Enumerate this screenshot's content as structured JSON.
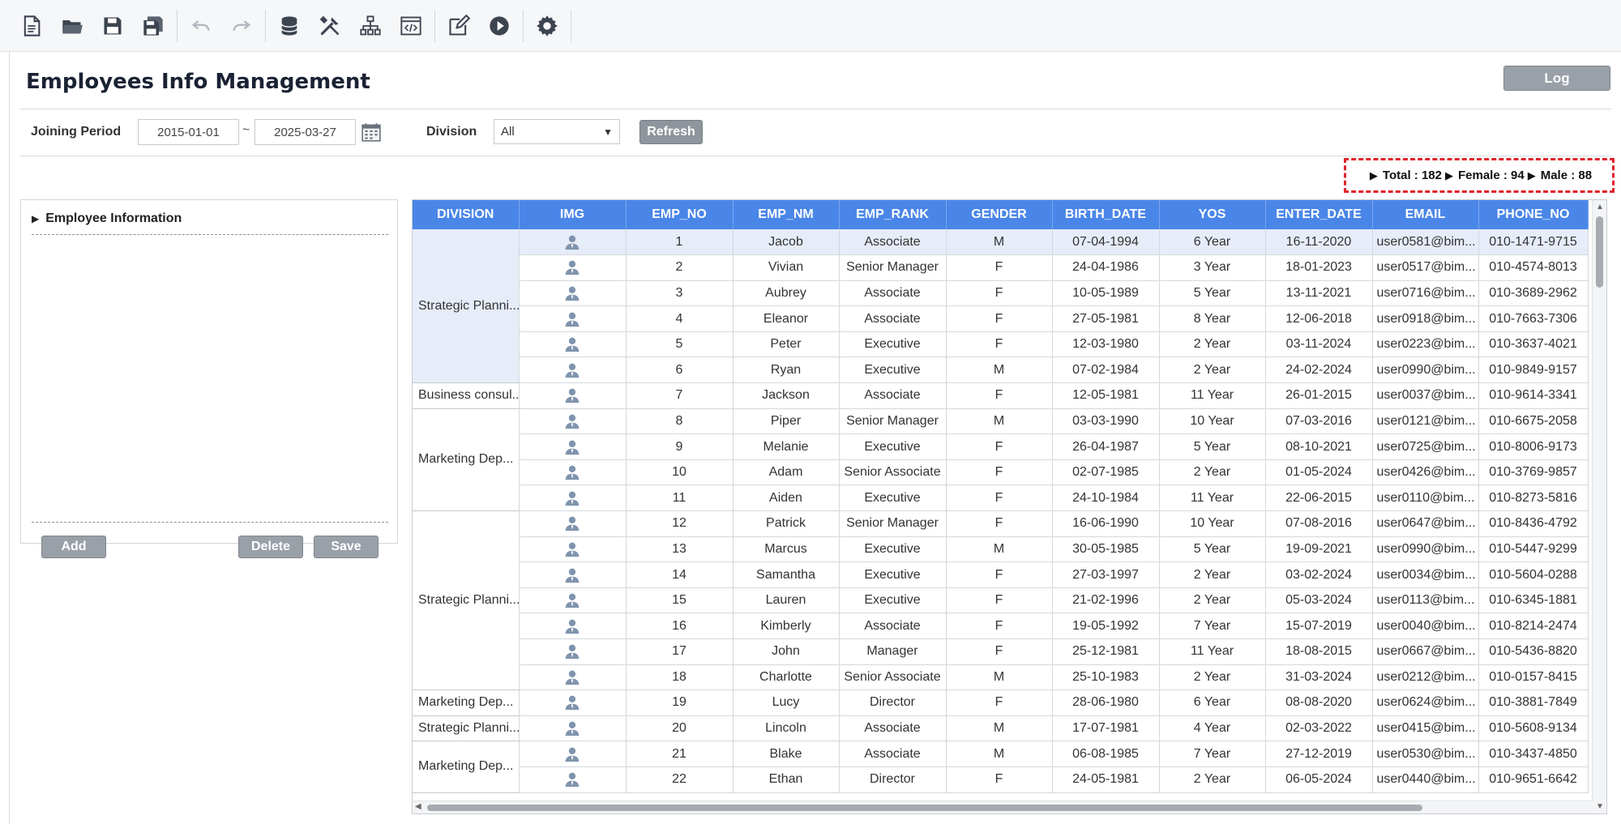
{
  "app": {
    "title": "Employees Info Management",
    "log_label": "Log"
  },
  "toolbar": {
    "icons": [
      "new-file-icon",
      "open-folder-icon",
      "save-icon",
      "save-all-icon",
      "undo-icon",
      "redo-icon",
      "database-icon",
      "tools-icon",
      "hierarchy-icon",
      "code-icon",
      "edit-icon",
      "run-icon",
      "settings-icon"
    ]
  },
  "filter": {
    "joining_label": "Joining Period",
    "start_date": "2015-01-01",
    "separator": "~",
    "end_date": "2025-03-27",
    "division_label": "Division",
    "division_value": "All",
    "refresh_label": "Refresh"
  },
  "stats": {
    "total": "Total : 182",
    "female": "Female : 94",
    "male": "Male : 88"
  },
  "info_panel": {
    "title": "Employee Information",
    "add_label": "Add",
    "delete_label": "Delete",
    "save_label": "Save"
  },
  "grid": {
    "columns": [
      "DIVISION",
      "IMG",
      "EMP_NO",
      "EMP_NM",
      "EMP_RANK",
      "GENDER",
      "BIRTH_DATE",
      "YOS",
      "ENTER_DATE",
      "EMAIL",
      "PHONE_NO"
    ],
    "divisions": [
      {
        "label": "Strategic Planni...",
        "rows": 6,
        "selected": true
      },
      {
        "label": "Business consul...",
        "rows": 1,
        "selected": false
      },
      {
        "label": "Marketing Dep...",
        "rows": 4,
        "selected": false
      },
      {
        "label": "Strategic Planni...",
        "rows": 7,
        "selected": false
      },
      {
        "label": "Marketing Dep...",
        "rows": 1,
        "selected": false
      },
      {
        "label": "Strategic Planni...",
        "rows": 1,
        "selected": false
      },
      {
        "label": "Marketing Dep...",
        "rows": 2,
        "selected": false
      }
    ],
    "rows": [
      [
        "1",
        "Jacob",
        "Associate",
        "M",
        "07-04-1994",
        "6 Year",
        "16-11-2020",
        "user0581@bim...",
        "010-1471-9715"
      ],
      [
        "2",
        "Vivian",
        "Senior Manager",
        "F",
        "24-04-1986",
        "3 Year",
        "18-01-2023",
        "user0517@bim...",
        "010-4574-8013"
      ],
      [
        "3",
        "Aubrey",
        "Associate",
        "F",
        "10-05-1989",
        "5 Year",
        "13-11-2021",
        "user0716@bim...",
        "010-3689-2962"
      ],
      [
        "4",
        "Eleanor",
        "Associate",
        "F",
        "27-05-1981",
        "8 Year",
        "12-06-2018",
        "user0918@bim...",
        "010-7663-7306"
      ],
      [
        "5",
        "Peter",
        "Executive",
        "F",
        "12-03-1980",
        "2 Year",
        "03-11-2024",
        "user0223@bim...",
        "010-3637-4021"
      ],
      [
        "6",
        "Ryan",
        "Executive",
        "M",
        "07-02-1984",
        "2 Year",
        "24-02-2024",
        "user0990@bim...",
        "010-9849-9157"
      ],
      [
        "7",
        "Jackson",
        "Associate",
        "F",
        "12-05-1981",
        "11 Year",
        "26-01-2015",
        "user0037@bim...",
        "010-9614-3341"
      ],
      [
        "8",
        "Piper",
        "Senior Manager",
        "M",
        "03-03-1990",
        "10 Year",
        "07-03-2016",
        "user0121@bim...",
        "010-6675-2058"
      ],
      [
        "9",
        "Melanie",
        "Executive",
        "F",
        "26-04-1987",
        "5 Year",
        "08-10-2021",
        "user0725@bim...",
        "010-8006-9173"
      ],
      [
        "10",
        "Adam",
        "Senior Associate",
        "F",
        "02-07-1985",
        "2 Year",
        "01-05-2024",
        "user0426@bim...",
        "010-3769-9857"
      ],
      [
        "11",
        "Aiden",
        "Executive",
        "F",
        "24-10-1984",
        "11 Year",
        "22-06-2015",
        "user0110@bim...",
        "010-8273-5816"
      ],
      [
        "12",
        "Patrick",
        "Senior Manager",
        "F",
        "16-06-1990",
        "10 Year",
        "07-08-2016",
        "user0647@bim...",
        "010-8436-4792"
      ],
      [
        "13",
        "Marcus",
        "Executive",
        "M",
        "30-05-1985",
        "5 Year",
        "19-09-2021",
        "user0990@bim...",
        "010-5447-9299"
      ],
      [
        "14",
        "Samantha",
        "Executive",
        "F",
        "27-03-1997",
        "2 Year",
        "03-02-2024",
        "user0034@bim...",
        "010-5604-0288"
      ],
      [
        "15",
        "Lauren",
        "Executive",
        "F",
        "21-02-1996",
        "2 Year",
        "05-03-2024",
        "user0113@bim...",
        "010-6345-1881"
      ],
      [
        "16",
        "Kimberly",
        "Associate",
        "F",
        "19-05-1992",
        "7 Year",
        "15-07-2019",
        "user0040@bim...",
        "010-8214-2474"
      ],
      [
        "17",
        "John",
        "Manager",
        "F",
        "25-12-1981",
        "11 Year",
        "18-08-2015",
        "user0667@bim...",
        "010-5436-8820"
      ],
      [
        "18",
        "Charlotte",
        "Senior Associate",
        "M",
        "25-10-1983",
        "2 Year",
        "31-03-2024",
        "user0212@bim...",
        "010-0157-8415"
      ],
      [
        "19",
        "Lucy",
        "Director",
        "F",
        "28-06-1980",
        "6 Year",
        "08-08-2020",
        "user0624@bim...",
        "010-3881-7849"
      ],
      [
        "20",
        "Lincoln",
        "Associate",
        "M",
        "17-07-1981",
        "4 Year",
        "02-03-2022",
        "user0415@bim...",
        "010-5608-9134"
      ],
      [
        "21",
        "Blake",
        "Associate",
        "M",
        "06-08-1985",
        "7 Year",
        "27-12-2019",
        "user0530@bim...",
        "010-3437-4850"
      ],
      [
        "22",
        "Ethan",
        "Director",
        "F",
        "24-05-1981",
        "2 Year",
        "06-05-2024",
        "user0440@bim...",
        "010-9651-6642"
      ]
    ]
  },
  "colors": {
    "header_blue": "#4a86e8",
    "selected_division": "#c9d5f5",
    "selected_row": "#e7ecf9",
    "stats_border": "#e0232a"
  }
}
